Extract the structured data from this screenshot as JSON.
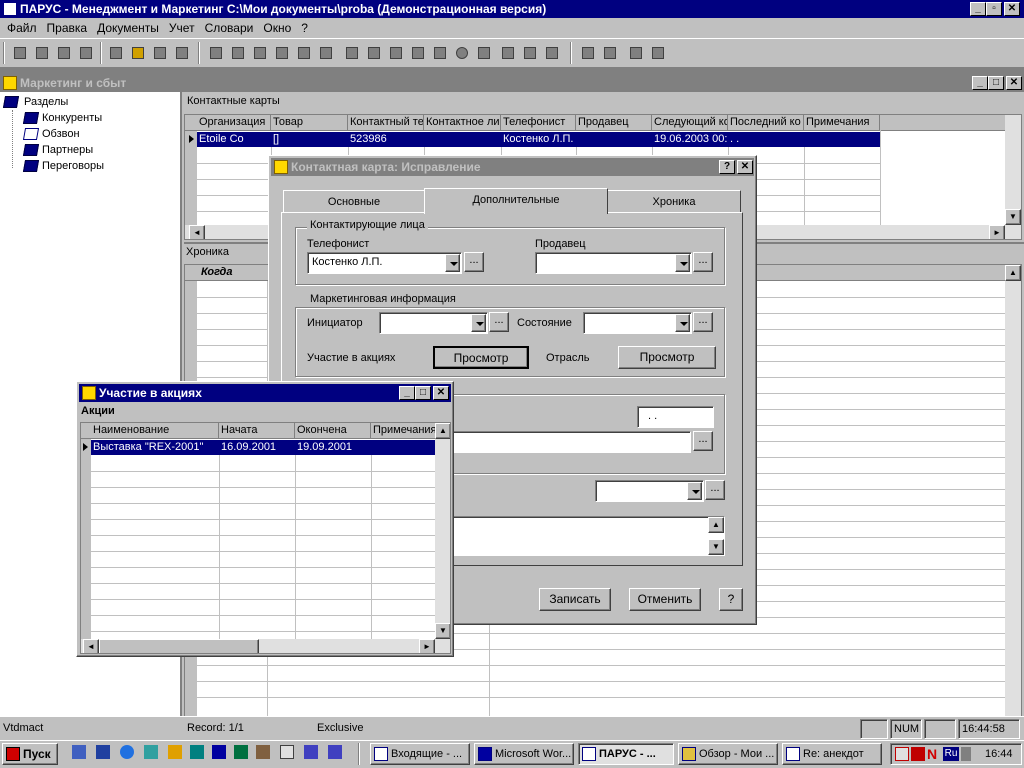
{
  "app": {
    "title": "ПАРУС - Менеджмент и Маркетинг  C:\\Мои документы\\proba (Демонстрационная версия)"
  },
  "menu": [
    "Файл",
    "Правка",
    "Документы",
    "Учет",
    "Словари",
    "Окно",
    "?"
  ],
  "mdi": {
    "title": "Маркетинг и сбыт"
  },
  "tree": {
    "root": "Разделы",
    "items": [
      "Конкуренты",
      "Обзвон",
      "Партнеры",
      "Переговоры"
    ]
  },
  "cards": {
    "title": "Контактные карты",
    "columns": [
      "Организация",
      "Товар",
      "Контактный те",
      "Контактное ли",
      "Телефонист",
      "Продавец",
      "Следующий ко",
      "Последний ко",
      "Примечания"
    ],
    "row": [
      "Etoile Co",
      "[]",
      "523986",
      "",
      "Костенко Л.П.",
      "",
      "19.06.2003 00:",
      ". .",
      ""
    ]
  },
  "chronicle": {
    "title": "Хроника",
    "column": "Когда"
  },
  "dialog": {
    "title": "Контактная карта: Исправление",
    "tabs": [
      "Основные",
      "Дополнительные",
      "Хроника"
    ],
    "group_contacts": "Контактирующие лица",
    "telephonist_label": "Телефонист",
    "telephonist_value": "Костенко Л.П.",
    "seller_label": "Продавец",
    "seller_value": "",
    "group_marketing": "Маркетинговая информация",
    "initiator_label": "Инициатор",
    "state_label": "Состояние",
    "actions_label": "Участие в акциях",
    "view_button": "Просмотр",
    "industry_label": "Отрасль",
    "date_value": ". .",
    "ellipsis": "...",
    "save_button": "Записать",
    "cancel_button": "Отменить",
    "help_button": "?"
  },
  "actions_window": {
    "title": "Участие в акциях",
    "subtitle": "Акции",
    "columns": [
      "Наименование",
      "Начата",
      "Окончена",
      "Примечания"
    ],
    "row": [
      "Выставка \"REX-2001\"",
      "16.09.2001",
      "19.09.2001",
      ""
    ]
  },
  "statusbar": {
    "left": "Vtdmact",
    "record": "Record: 1/1",
    "mode": "Exclusive",
    "num": "NUM",
    "time": "16:44:58"
  },
  "taskbar": {
    "start": "Пуск",
    "tasks": [
      "Входящие - ...",
      "Microsoft Wor...",
      "ПАРУС - ...",
      "Обзор - Мои ...",
      "Re: анекдот"
    ],
    "lang": "Ru",
    "clock": "16:44"
  },
  "colors": {
    "face": "#c0c0c0",
    "title_active": "#000080",
    "selection": "#000080",
    "desktop_workspace": "#808080"
  }
}
